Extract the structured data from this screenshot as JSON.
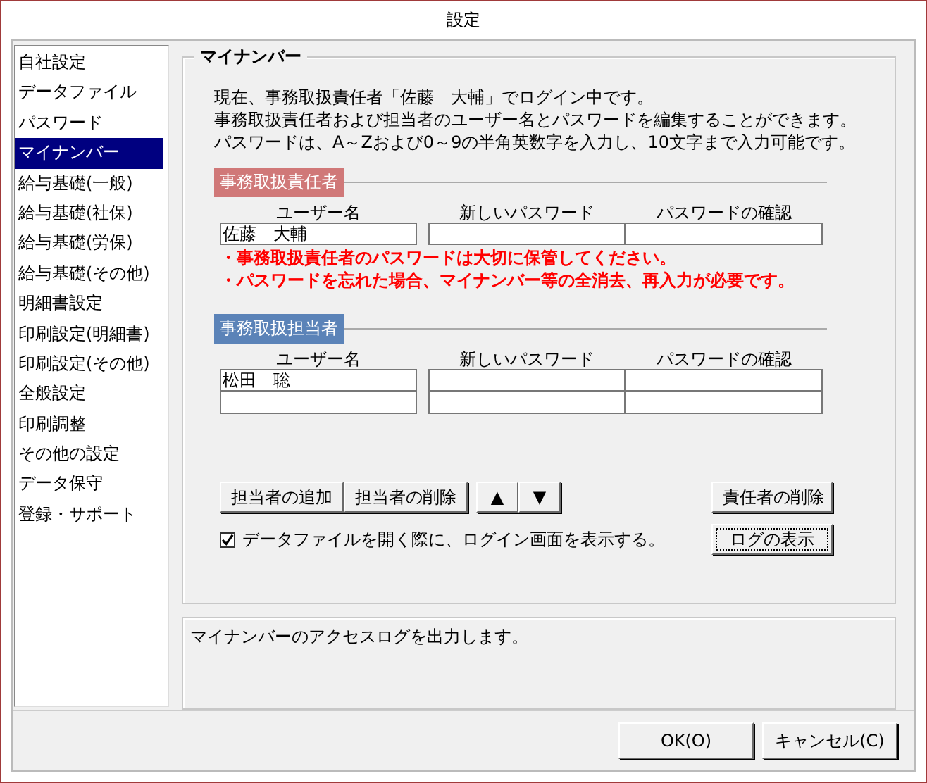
{
  "window": {
    "title": "設定"
  },
  "sidebar": {
    "items": [
      {
        "label": "自社設定",
        "selected": false
      },
      {
        "label": "データファイル",
        "selected": false
      },
      {
        "label": "パスワード",
        "selected": false
      },
      {
        "label": "マイナンバー",
        "selected": true
      },
      {
        "label": "給与基礎(一般)",
        "selected": false
      },
      {
        "label": "給与基礎(社保)",
        "selected": false
      },
      {
        "label": "給与基礎(労保)",
        "selected": false
      },
      {
        "label": "給与基礎(その他)",
        "selected": false
      },
      {
        "label": "明細書設定",
        "selected": false
      },
      {
        "label": "印刷設定(明細書)",
        "selected": false
      },
      {
        "label": "印刷設定(その他)",
        "selected": false
      },
      {
        "label": "全般設定",
        "selected": false
      },
      {
        "label": "印刷調整",
        "selected": false
      },
      {
        "label": "その他の設定",
        "selected": false
      },
      {
        "label": "データ保守",
        "selected": false
      },
      {
        "label": "登録・サポート",
        "selected": false
      }
    ]
  },
  "group": {
    "title": "マイナンバー",
    "intro": [
      "現在、事務取扱責任者「佐藤　大輔」でログイン中です。",
      "事務取扱責任者および担当者のユーザー名とパスワードを編集することができます。",
      "パスワードは、A～Zおよび0～9の半角英数字を入力し、10文字まで入力可能です。"
    ],
    "sections": [
      {
        "title": "事務取扱責任者",
        "color": "#d07878",
        "columns": [
          "ユーザー名",
          "新しいパスワード",
          "パスワードの確認"
        ],
        "rows": [
          [
            "佐藤　大輔",
            "",
            ""
          ]
        ],
        "warnings": [
          "・事務取扱責任者のパスワードは大切に保管してください。",
          "・パスワードを忘れた場合、マイナンバー等の全消去、再入力が必要です。"
        ]
      },
      {
        "title": "事務取扱担当者",
        "color": "#5b83b8",
        "columns": [
          "ユーザー名",
          "新しいパスワード",
          "パスワードの確認"
        ],
        "rows": [
          [
            "松田　聡",
            "",
            ""
          ],
          [
            "",
            "",
            ""
          ]
        ]
      }
    ],
    "buttons": [
      "担当者の追加",
      "担当者の削除"
    ],
    "arrows": [
      "▲",
      "▼"
    ],
    "delete_button": "責任者の削除",
    "checkbox": {
      "label": "データファイルを開く際に、ログイン画面を表示する。",
      "checked": true
    },
    "log_button": {
      "label": "ログの表示",
      "focused": true
    }
  },
  "description": "マイナンバーのアクセスログを出力します。",
  "footer_buttons": [
    "OK(O)",
    "キャンセル(C)"
  ]
}
